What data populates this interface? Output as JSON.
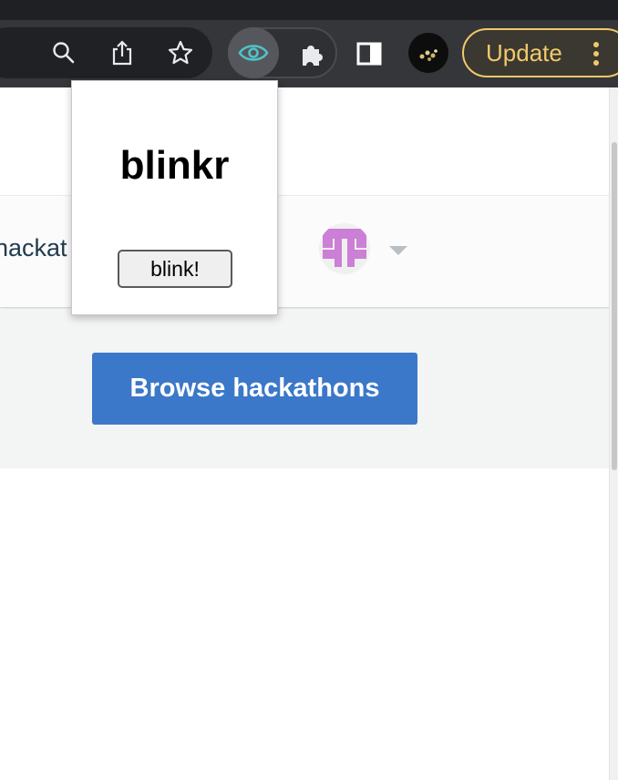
{
  "browser": {
    "update_label": "Update",
    "icons": {
      "search": "search-icon",
      "share": "share-icon",
      "bookmark": "star-icon",
      "extension_active": "eye-icon",
      "extensions": "puzzle-icon",
      "side_panel": "side-panel-icon",
      "more": "kebab-menu-icon"
    },
    "colors": {
      "toolbar": "#35363a",
      "update_accent": "#f2c86a",
      "eye_accent": "#4fc3c9"
    }
  },
  "page": {
    "nav_link_label": "hackat",
    "cta_label": "Browse hackathons",
    "colors": {
      "cta": "#3b78c9",
      "avatar": "#cc7fd6"
    }
  },
  "popup": {
    "title": "blinkr",
    "button_label": "blink!"
  }
}
